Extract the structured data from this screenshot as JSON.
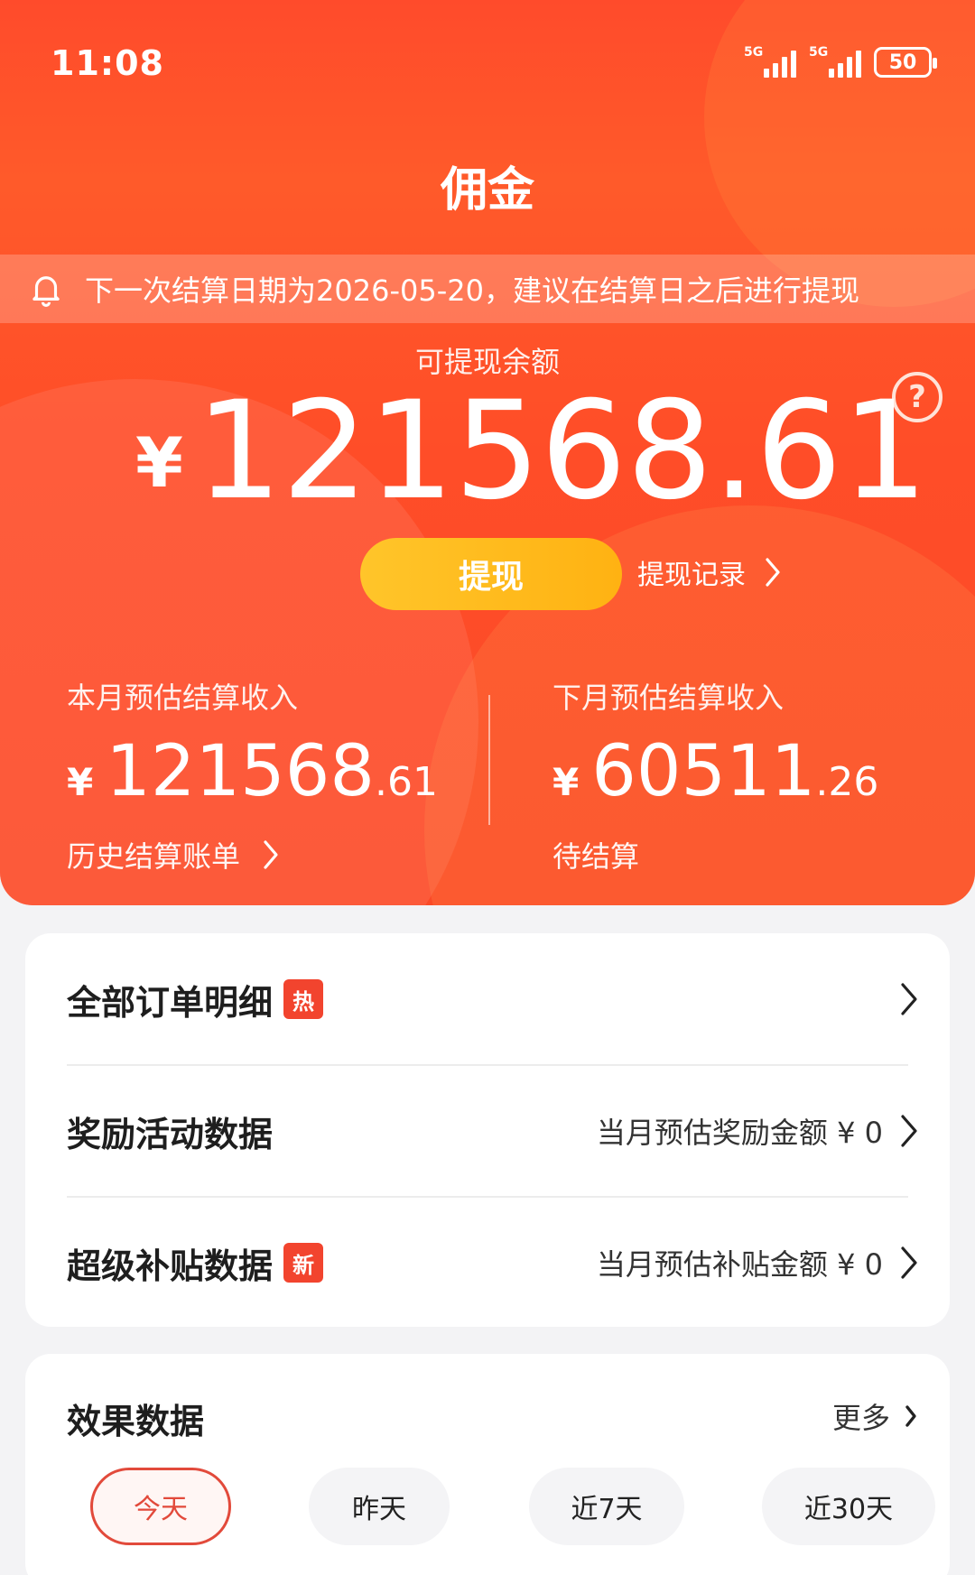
{
  "status_bar": {
    "time": "11:08",
    "network1": "5G",
    "network2": "5G",
    "battery": "50"
  },
  "header": {
    "title": "佣金"
  },
  "notice": {
    "text": "下一次结算日期为2026-05-20，建议在结算日之后进行提现"
  },
  "balance": {
    "label": "可提现余额",
    "currency": "¥",
    "amount": "121568.61",
    "withdraw_label": "提现",
    "record_label": "提现记录"
  },
  "stats": {
    "this_month": {
      "label": "本月预估结算收入",
      "currency": "¥",
      "integer": "121568",
      "decimal": ".61",
      "link": "历史结算账单"
    },
    "next_month": {
      "label": "下月预估结算收入",
      "currency": "¥",
      "integer": "60511",
      "decimal": ".26",
      "status": "待结算"
    }
  },
  "list": {
    "orders": {
      "title": "全部订单明细",
      "tag": "热"
    },
    "rewards": {
      "title": "奖励活动数据",
      "value": "当月预估奖励金额 ¥ 0"
    },
    "subsidy": {
      "title": "超级补贴数据",
      "tag": "新",
      "value": "当月预估补贴金额 ¥ 0"
    }
  },
  "effect": {
    "title": "效果数据",
    "more": "更多",
    "tabs": [
      "今天",
      "昨天",
      "近7天",
      "近30天"
    ],
    "active_tab": "今天"
  },
  "colors": {
    "primary": "#ff4b2b",
    "button": "#ffbb1e",
    "tag": "#f2442e",
    "active_tab": "#e24a3b"
  },
  "icons": [
    "bell-icon",
    "help-icon",
    "chevron-right-icon"
  ]
}
